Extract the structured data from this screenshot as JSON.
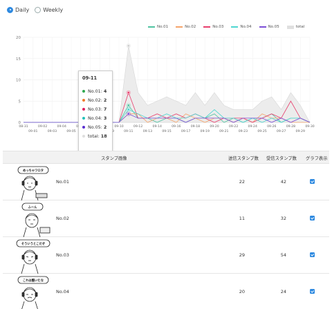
{
  "toggle": {
    "daily_label": "Daily",
    "weekly_label": "Weekly",
    "selected": "Daily"
  },
  "legend": [
    {
      "label": "No.01",
      "color": "#4fc3a1"
    },
    {
      "label": "No.02",
      "color": "#f5a36a"
    },
    {
      "label": "No.03",
      "color": "#e83e6c"
    },
    {
      "label": "No.04",
      "color": "#4dd6d0"
    },
    {
      "label": "No.05",
      "color": "#7c4dd6"
    },
    {
      "label": "total",
      "color": "#d8d8d8"
    }
  ],
  "chart_data": {
    "type": "line",
    "x_top_ticks": [
      "08-31",
      "09-02",
      "09-04",
      "09-06",
      "09-08",
      "09-10",
      "09-12",
      "09-14",
      "09-16",
      "09-18",
      "09-20",
      "09-22",
      "09-24",
      "09-26",
      "09-28",
      "09-30"
    ],
    "x_bottom_ticks": [
      "09-01",
      "09-03",
      "09-05",
      "09-07",
      "09-09",
      "09-11",
      "09-13",
      "09-15",
      "09-17",
      "09-19",
      "09-21",
      "09-23",
      "09-25",
      "09-27",
      "09-29"
    ],
    "y_ticks": [
      "0",
      "5",
      "10",
      "15",
      "20"
    ],
    "ylim": [
      0,
      20
    ],
    "grid": true,
    "legend_position": "top-right",
    "x": [
      "08-31",
      "09-01",
      "09-02",
      "09-03",
      "09-04",
      "09-05",
      "09-06",
      "09-07",
      "09-08",
      "09-09",
      "09-10",
      "09-11",
      "09-12",
      "09-13",
      "09-14",
      "09-15",
      "09-16",
      "09-17",
      "09-18",
      "09-19",
      "09-20",
      "09-21",
      "09-22",
      "09-23",
      "09-24",
      "09-25",
      "09-26",
      "09-27",
      "09-28",
      "09-29",
      "09-30"
    ],
    "series": [
      {
        "name": "No.01",
        "color": "#4fc3a1",
        "values": [
          0,
          0,
          0,
          0,
          0,
          0,
          0,
          0,
          0,
          0,
          0,
          4,
          1,
          1,
          0,
          1,
          1,
          0,
          1,
          1,
          2,
          0,
          1,
          0,
          1,
          1,
          2,
          0,
          1,
          1,
          0
        ]
      },
      {
        "name": "No.02",
        "color": "#f5a36a",
        "values": [
          0,
          0,
          0,
          0,
          0,
          0,
          0,
          0,
          0,
          0,
          0,
          2,
          2,
          0,
          1,
          1,
          0,
          2,
          1,
          0,
          1,
          1,
          0,
          1,
          0,
          2,
          1,
          1,
          0,
          0,
          0
        ]
      },
      {
        "name": "No.03",
        "color": "#e83e6c",
        "values": [
          0,
          0,
          0,
          0,
          0,
          0,
          0,
          0,
          0,
          0,
          0,
          7,
          1,
          1,
          2,
          1,
          2,
          1,
          2,
          1,
          0,
          1,
          1,
          1,
          0,
          1,
          2,
          1,
          5,
          1,
          0
        ]
      },
      {
        "name": "No.04",
        "color": "#4dd6d0",
        "values": [
          0,
          0,
          0,
          0,
          0,
          0,
          0,
          0,
          0,
          0,
          0,
          3,
          2,
          1,
          1,
          2,
          1,
          1,
          2,
          1,
          3,
          1,
          1,
          0,
          1,
          0,
          1,
          0,
          1,
          1,
          0
        ]
      },
      {
        "name": "No.05",
        "color": "#7c4dd6",
        "values": [
          0,
          0,
          0,
          0,
          0,
          0,
          0,
          0,
          0,
          0,
          0,
          2,
          1,
          1,
          1,
          1,
          1,
          0,
          1,
          1,
          1,
          1,
          0,
          1,
          1,
          1,
          0,
          1,
          0,
          1,
          0
        ]
      },
      {
        "name": "total",
        "color": "#d8d8d8",
        "type": "area",
        "values": [
          0,
          0,
          0,
          0,
          0,
          0,
          0,
          0,
          0,
          0,
          0,
          18,
          7,
          4,
          5,
          6,
          5,
          4,
          7,
          4,
          7,
          4,
          3,
          3,
          3,
          5,
          6,
          3,
          7,
          4,
          0
        ]
      }
    ]
  },
  "tooltip": {
    "date": "09-11",
    "rows": [
      {
        "label": "No.01:",
        "value": "4",
        "color": "#2fa84f"
      },
      {
        "label": "No.02:",
        "value": "2",
        "color": "#f07a28"
      },
      {
        "label": "No.03:",
        "value": "7",
        "color": "#e0205f"
      },
      {
        "label": "No.04:",
        "value": "3",
        "color": "#24c1b9"
      },
      {
        "label": "No.05:",
        "value": "2",
        "color": "#5a2fd0"
      },
      {
        "label": "total:",
        "value": "18",
        "color": "#dedede"
      }
    ]
  },
  "table": {
    "headers": {
      "image": "スタンプ画像",
      "sent": "送信スタンプ数",
      "received": "受信スタンプ数",
      "graph": "グラフ表示"
    },
    "rows": [
      {
        "bubble": "めっちゃワロタ",
        "name": "No.01",
        "sent": "22",
        "received": "42",
        "checked": true
      },
      {
        "bubble": "ふーん",
        "name": "No.02",
        "sent": "11",
        "received": "32",
        "checked": true
      },
      {
        "bubble": "そういうとこだぞ",
        "name": "No.03",
        "sent": "29",
        "received": "54",
        "checked": true
      },
      {
        "bubble": "これは酷いたな",
        "name": "No.04",
        "sent": "20",
        "received": "24",
        "checked": true
      }
    ]
  }
}
